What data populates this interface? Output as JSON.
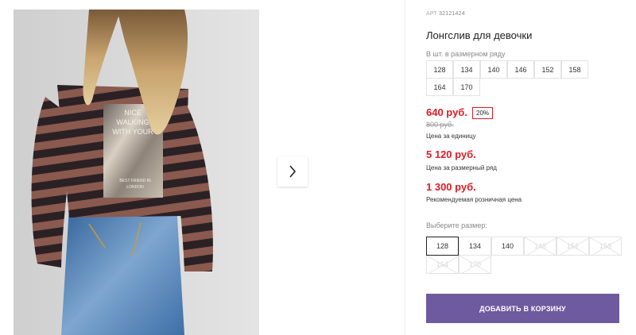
{
  "product": {
    "article_prefix": "АРТ",
    "article": "32121424",
    "title": "Лонгслив для девочки",
    "image": {
      "alt": "Photo of a girl in a striped longsleeve with a metallic print",
      "print_lines": [
        "NICE",
        "WALKING",
        "WITH YOUR",
        "BEST FRIEND IN",
        "LONDON"
      ]
    }
  },
  "size_row": {
    "label": "В шт. в размерном ряду",
    "sizes": [
      "128",
      "134",
      "140",
      "146",
      "152",
      "158",
      "164",
      "170"
    ]
  },
  "pricing": {
    "price": "640 руб.",
    "discount": "20%",
    "old_price": "800 руб.",
    "price_label": "Цена за единицу",
    "row_price": "5 120 руб.",
    "row_price_label": "Цена за размерный ряд",
    "retail_price": "1 300 руб.",
    "retail_price_label": "Рекомендуемая розничная цена"
  },
  "size_picker": {
    "label": "Выберите размер:",
    "options": [
      {
        "value": "128",
        "selected": true,
        "available": true
      },
      {
        "value": "134",
        "selected": false,
        "available": true
      },
      {
        "value": "140",
        "selected": false,
        "available": true
      },
      {
        "value": "146",
        "selected": false,
        "available": false
      },
      {
        "value": "152",
        "selected": false,
        "available": false
      },
      {
        "value": "158",
        "selected": false,
        "available": false
      },
      {
        "value": "164",
        "selected": false,
        "available": false
      },
      {
        "value": "170",
        "selected": false,
        "available": false
      }
    ]
  },
  "actions": {
    "add_to_cart": "ДОБАВИТЬ В КОРЗИНУ"
  },
  "colors": {
    "price_red": "#e01c24",
    "button_purple": "#6e5a9e",
    "stripe_dark": "#2b2124",
    "stripe_brown": "#8a5a4f",
    "jeans_blue": "#3d6fa8"
  }
}
